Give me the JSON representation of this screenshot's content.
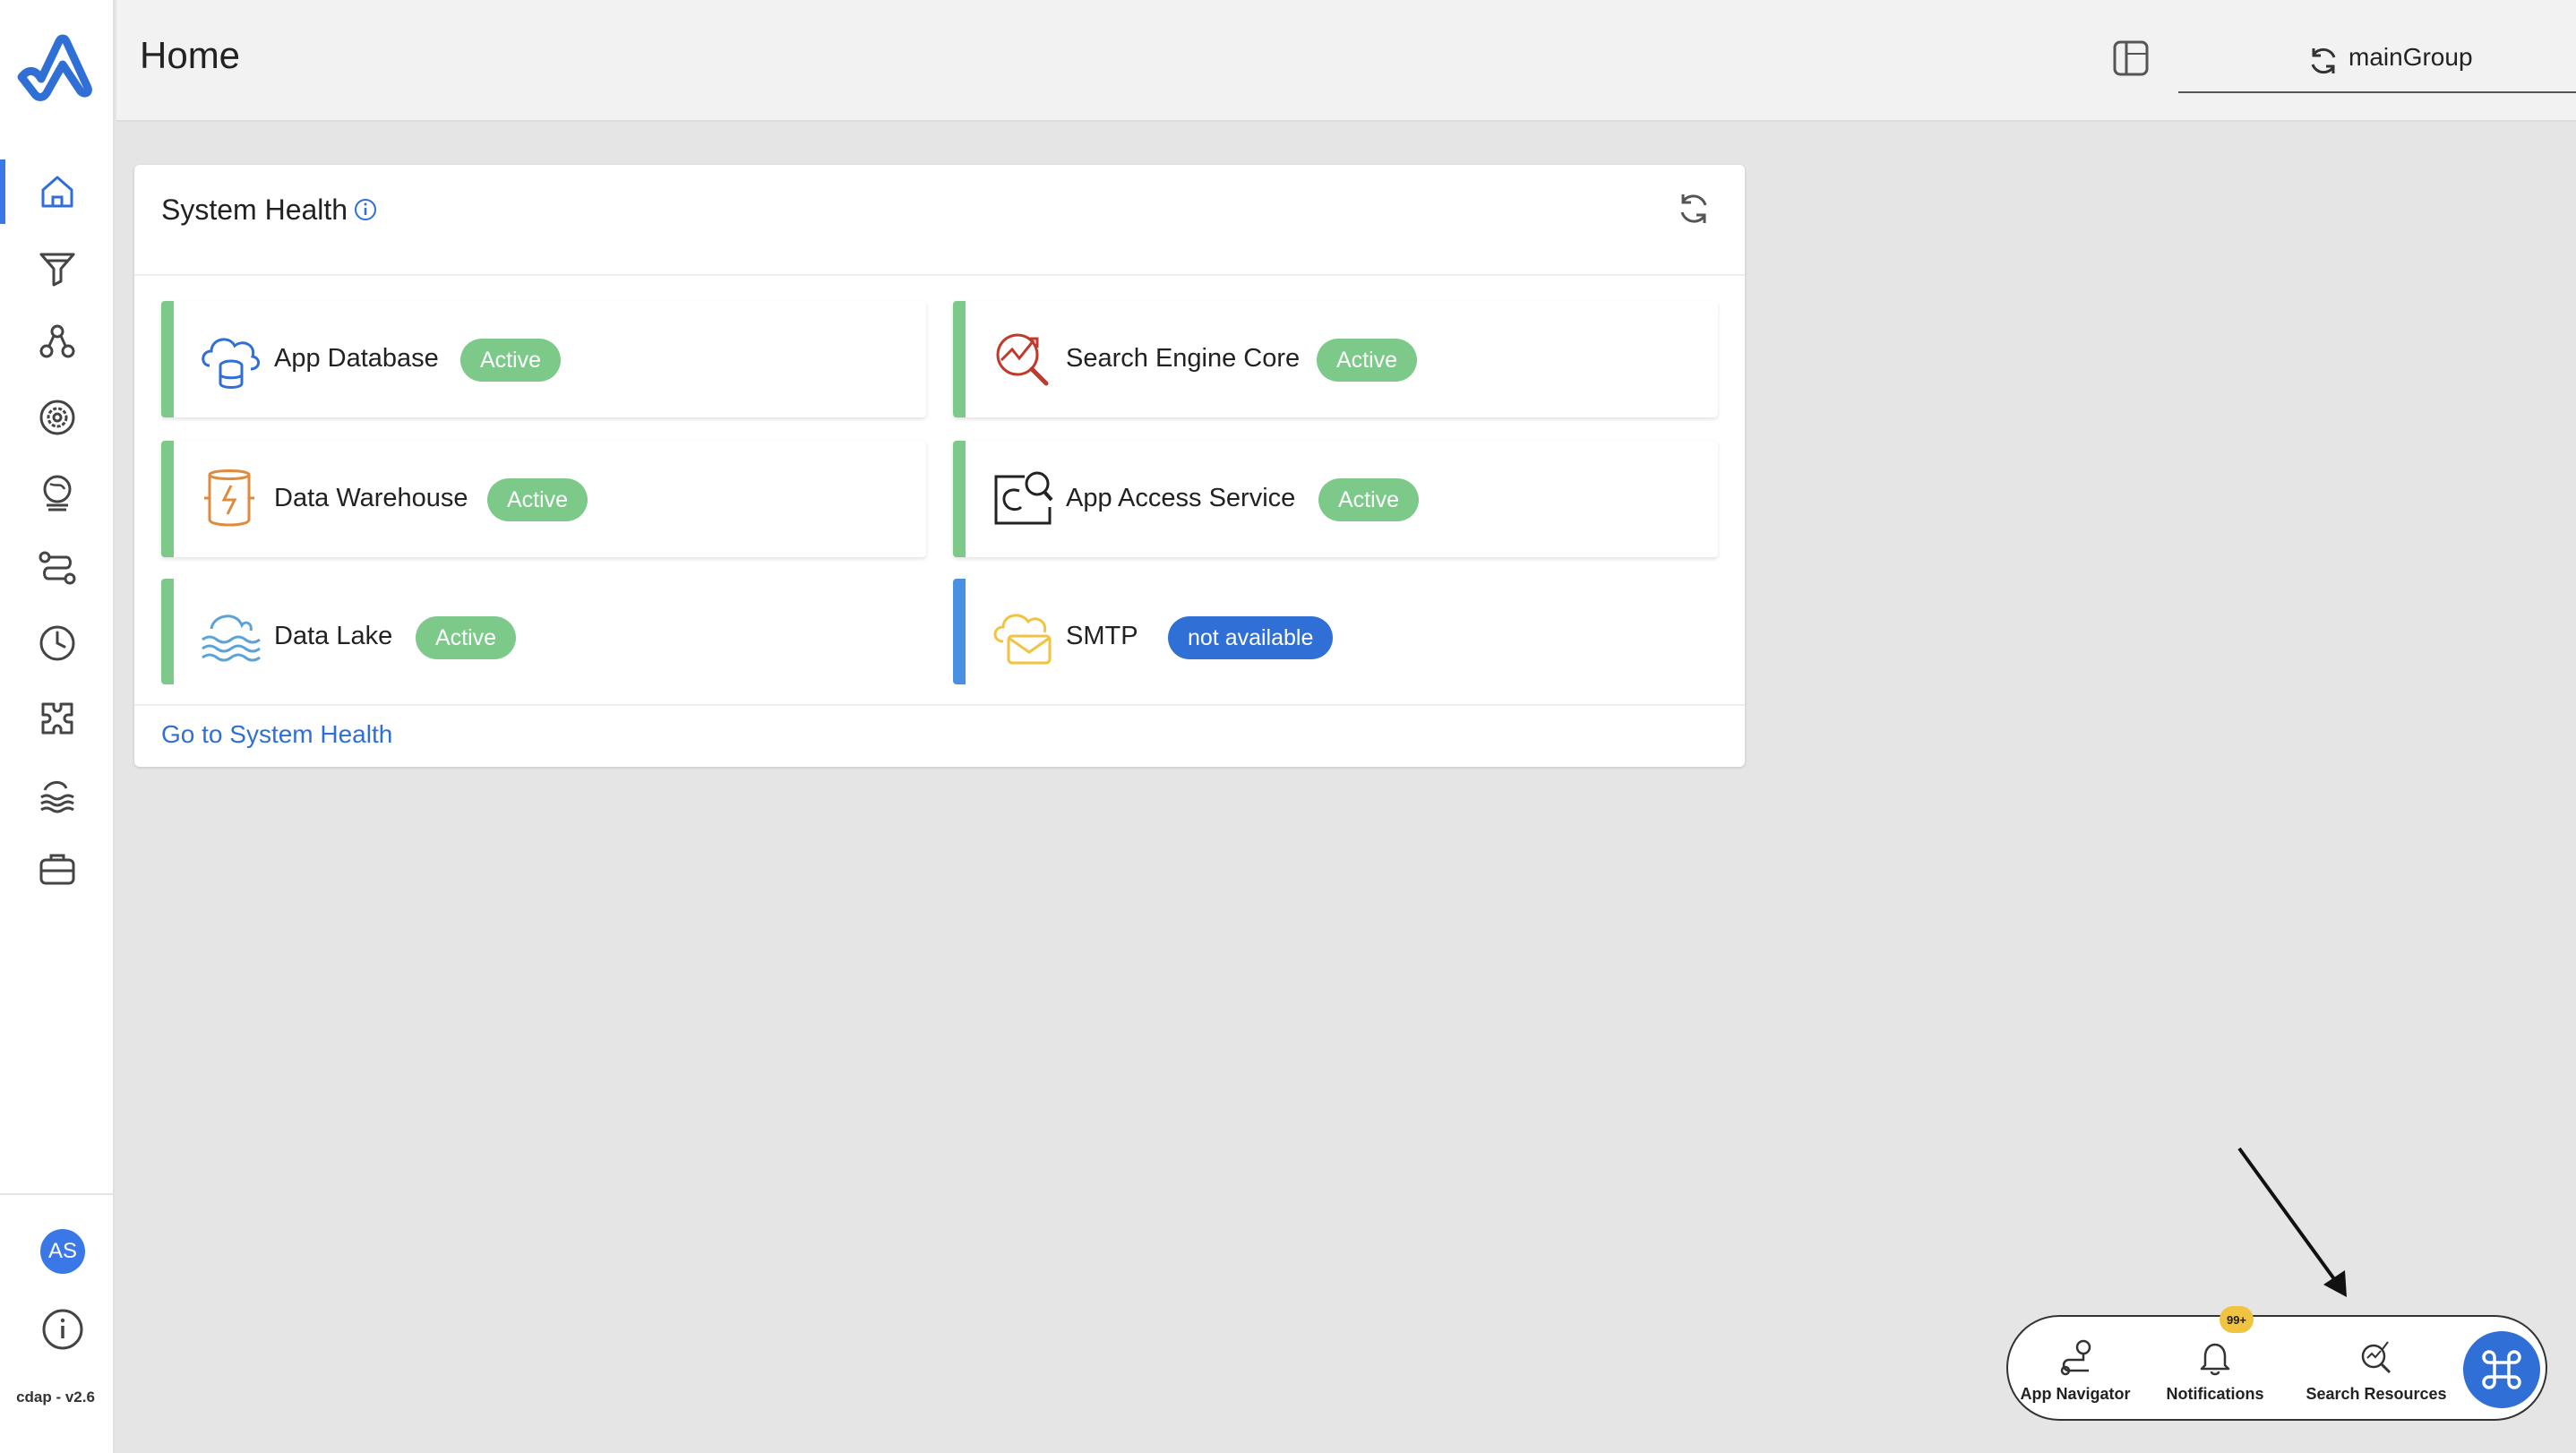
{
  "header": {
    "page_title": "Home",
    "namespace": "mainGroup"
  },
  "sidebar": {
    "items": [
      {
        "name": "home-icon",
        "active": true
      },
      {
        "name": "funnel-icon",
        "active": false
      },
      {
        "name": "nodes-icon",
        "active": false
      },
      {
        "name": "settings-gear-icon",
        "active": false
      },
      {
        "name": "globe-icon",
        "active": false
      },
      {
        "name": "route-icon",
        "active": false
      },
      {
        "name": "clock-icon",
        "active": false
      },
      {
        "name": "puzzle-icon",
        "active": false
      },
      {
        "name": "data-lake-icon",
        "active": false
      },
      {
        "name": "briefcase-icon",
        "active": false
      }
    ],
    "avatar_initials": "AS",
    "version": "cdap - v2.6"
  },
  "system_health": {
    "title": "System Health",
    "link": "Go to System Health",
    "services": [
      {
        "name": "App Database",
        "status": "Active",
        "icon": "cloud-database-icon"
      },
      {
        "name": "Search Engine Core",
        "status": "Active",
        "icon": "search-chart-icon"
      },
      {
        "name": "Data Warehouse",
        "status": "Active",
        "icon": "warehouse-cylinder-icon"
      },
      {
        "name": "App Access Service",
        "status": "Active",
        "icon": "access-search-icon"
      },
      {
        "name": "Data Lake",
        "status": "Active",
        "icon": "waves-icon"
      },
      {
        "name": "SMTP",
        "status": "not available",
        "icon": "mail-cloud-icon"
      }
    ]
  },
  "dock": {
    "app_navigator": "App Navigator",
    "notifications": "Notifications",
    "notifications_count": "99+",
    "search_resources": "Search Resources"
  },
  "colors": {
    "accent": "#2f6fd6",
    "active_green": "#7dc98a",
    "badge_yellow": "#f0c341"
  }
}
